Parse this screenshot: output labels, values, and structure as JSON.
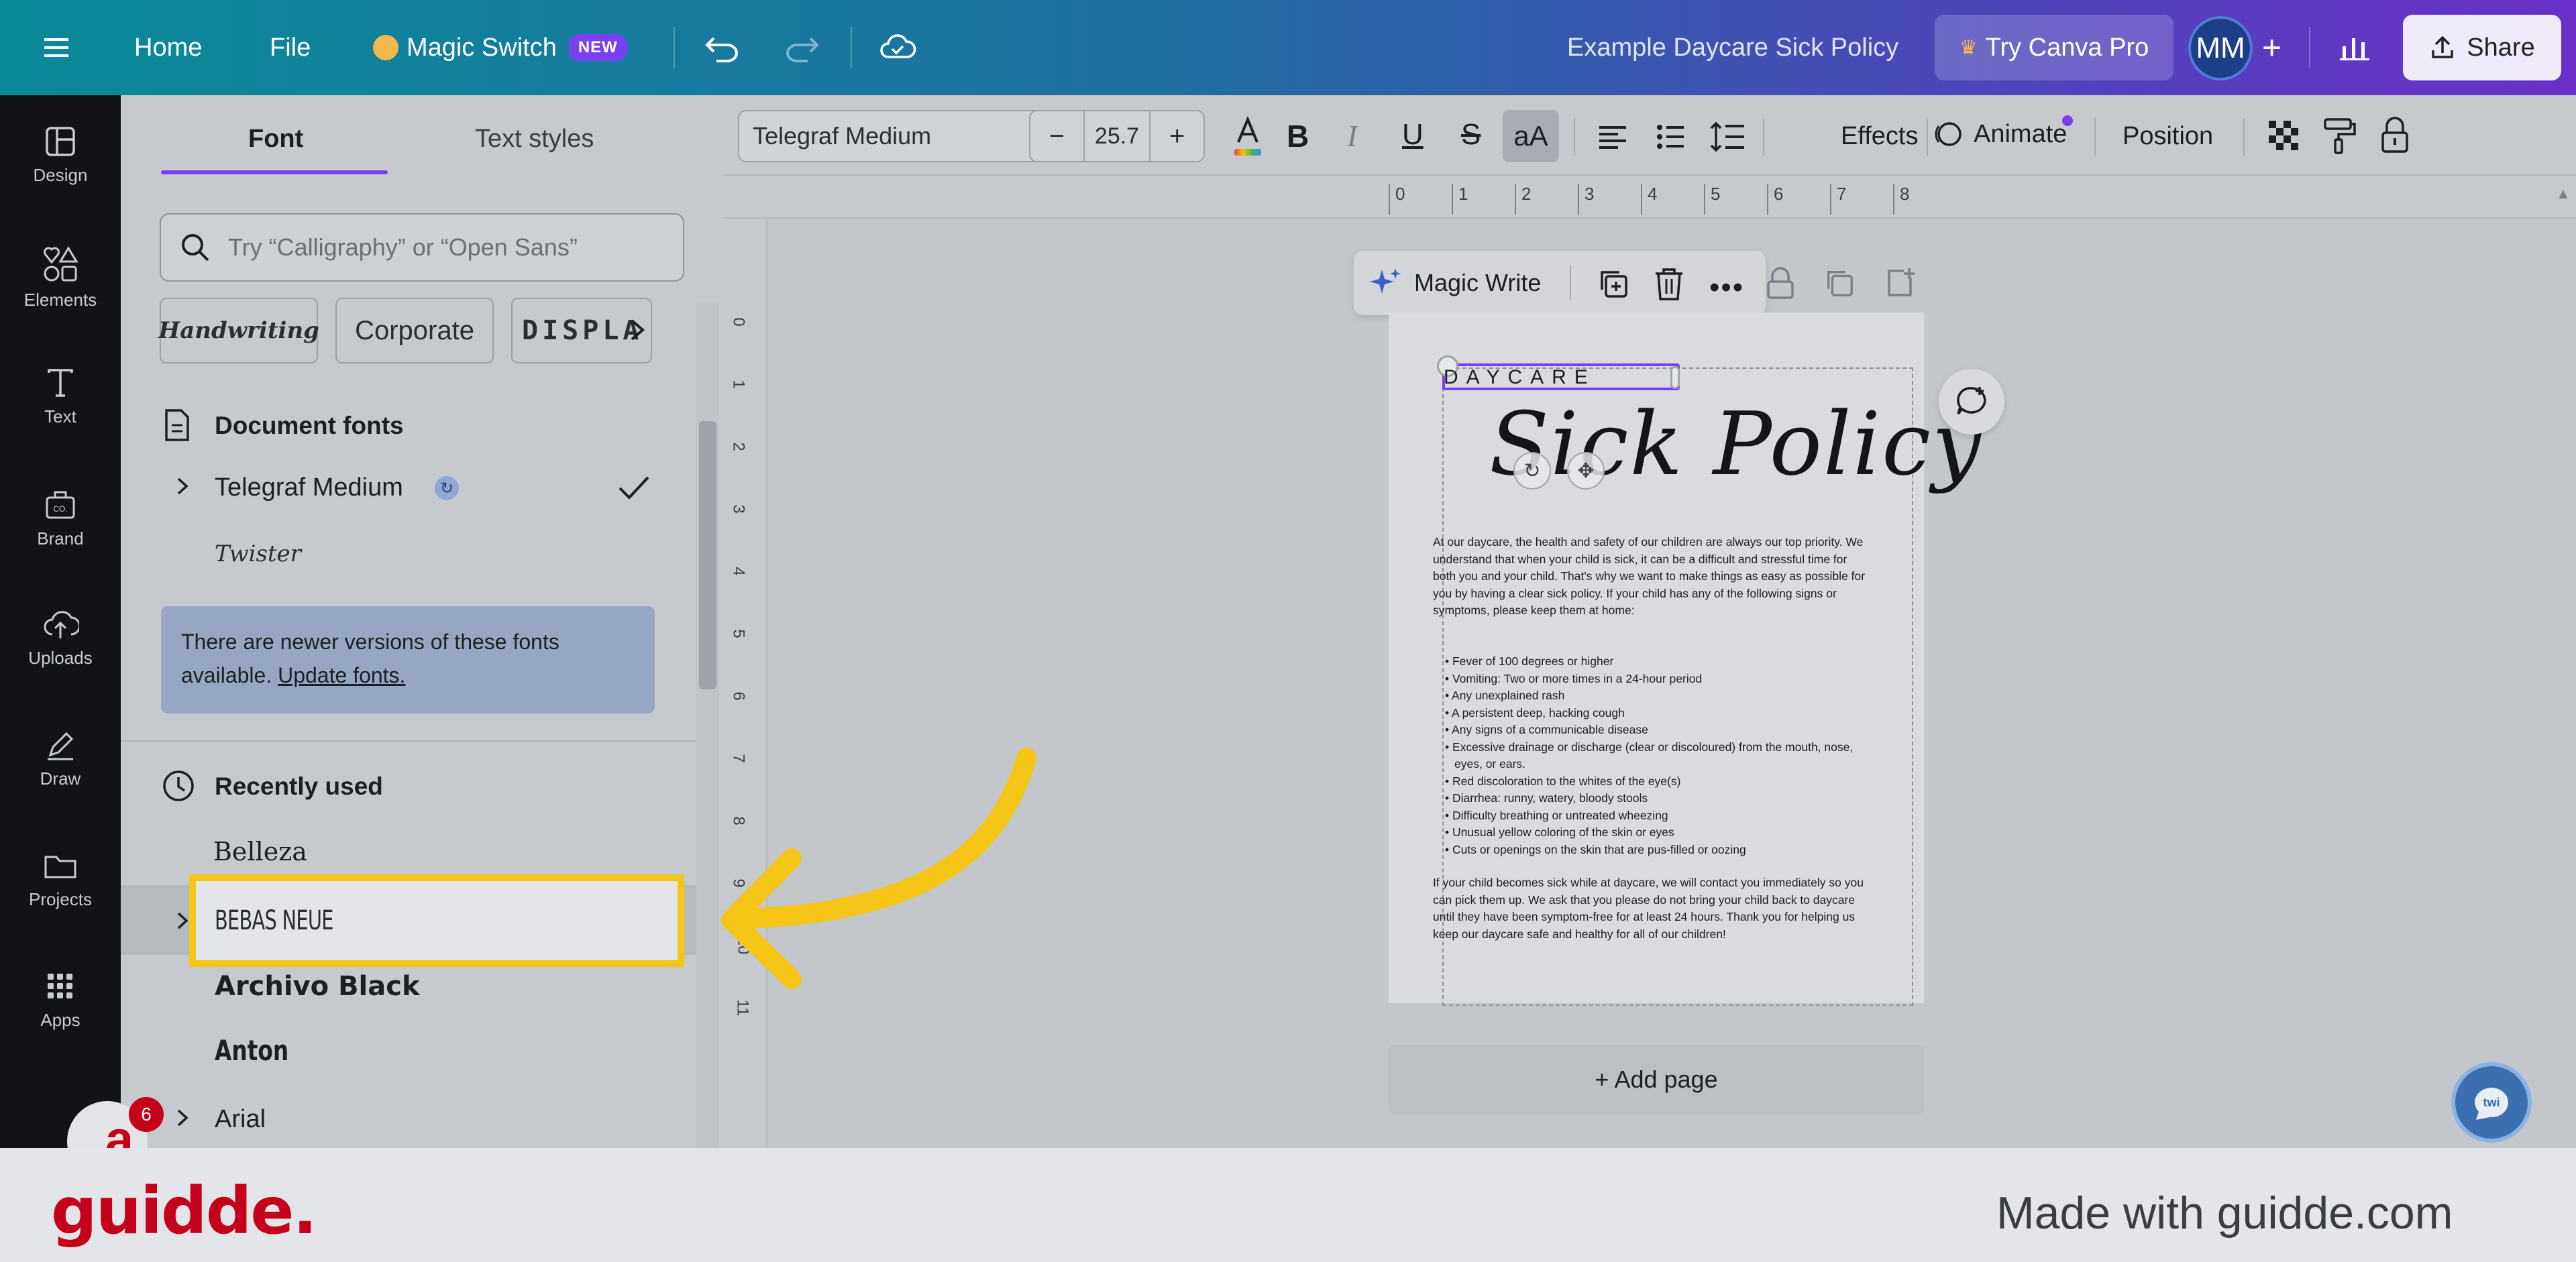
{
  "topbar": {
    "home": "Home",
    "file": "File",
    "magic_switch": "Magic Switch",
    "new_badge": "NEW",
    "doc_title": "Example Daycare Sick Policy",
    "try_pro": "Try Canva Pro",
    "avatar": "MM",
    "share": "Share"
  },
  "rail": {
    "design": "Design",
    "elements": "Elements",
    "text": "Text",
    "brand": "Brand",
    "uploads": "Uploads",
    "draw": "Draw",
    "projects": "Projects",
    "apps": "Apps"
  },
  "panel": {
    "tab_font": "Font",
    "tab_text_styles": "Text styles",
    "search_placeholder": "Try “Calligraphy” or “Open Sans”",
    "chips": [
      "Handwriting",
      "Corporate",
      "DISPLA"
    ],
    "document_fonts_heading": "Document fonts",
    "doc_font_1": "Telegraf Medium",
    "doc_font_2": "Twister",
    "notice_text": "There are newer versions of these fonts available.",
    "notice_link": "Update fonts.",
    "recent_heading": "Recently used",
    "recent_fonts": [
      "Belleza",
      "BEBAS NEUE",
      "Archivo Black",
      "Anton",
      "Arial"
    ],
    "notification_count": "6"
  },
  "toolbar": {
    "font_name": "Telegraf Medium",
    "font_size": "25.7",
    "minus": "−",
    "plus": "+",
    "effects": "Effects",
    "animate": "Animate",
    "position": "Position"
  },
  "ruler": {
    "h_ticks": [
      "0",
      "1",
      "2",
      "3",
      "4",
      "5",
      "6",
      "7",
      "8"
    ],
    "v_ticks": [
      "0",
      "1",
      "2",
      "3",
      "4",
      "5",
      "6",
      "7",
      "8",
      "9",
      "10",
      "11"
    ]
  },
  "float_toolbar": {
    "magic_write": "Magic Write"
  },
  "document": {
    "header_label": "DAYCARE",
    "title": "Sick Policy",
    "intro": "At our daycare, the health and safety of our children are always our top priority. We understand that when your child is sick, it can be a difficult and stressful time for both you and your child. That's why we want to make things as easy as possible for you by having a clear sick policy. If your child has any of the following signs or symptoms, please keep them at home:",
    "bullets": [
      "Fever of 100 degrees or higher",
      "Vomiting:  Two or more times in a 24-hour period",
      "Any unexplained rash",
      "A persistent deep, hacking cough",
      "Any signs of a communicable disease",
      "Excessive drainage or discharge (clear or discoloured) from the mouth, nose, eyes, or ears.",
      "Red discoloration to the whites of the eye(s)",
      "Diarrhea: runny, watery, bloody stools",
      "Difficulty breathing or untreated wheezing",
      "Unusual yellow coloring of the skin or eyes",
      "Cuts or openings on the skin that are pus-filled or oozing"
    ],
    "closing": "If your child becomes sick while at daycare, we will contact you immediately so you can pick them up. We ask that you please do not bring your child back to daycare until they have been symptom-free for at least 24 hours. Thank you for helping us keep our daycare safe and healthy for all of our children!"
  },
  "add_page": "+ Add page",
  "footer": {
    "brand": "guidde.",
    "made_with": "Made with guidde.com"
  },
  "colors": {
    "accent_yellow": "#f5c518",
    "brand_red": "#c4001a",
    "purple": "#7a3ff0"
  }
}
